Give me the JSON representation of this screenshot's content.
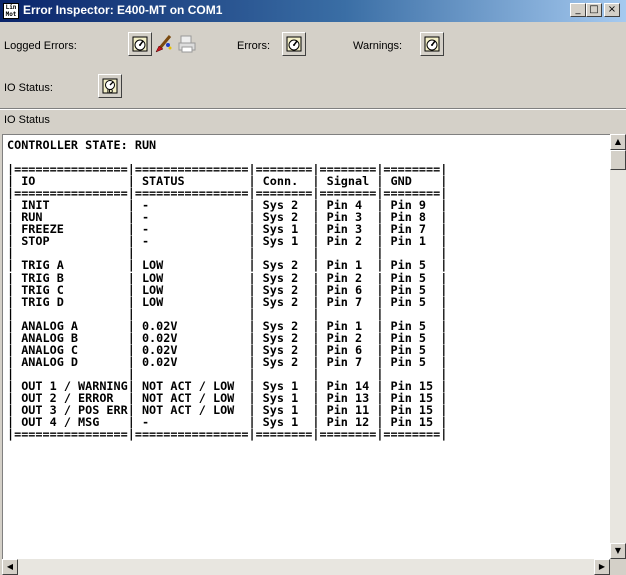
{
  "window": {
    "icon_text": "Lin Mot",
    "title": "Error Inspector: E400-MT on COM1",
    "minimize": "_",
    "maximize": "□",
    "close": "×"
  },
  "toolbar": {
    "logged_errors_label": "Logged Errors:",
    "errors_label": "Errors:",
    "warnings_label": "Warnings:",
    "io_status_label": "IO Status:"
  },
  "panel_caption": "IO Status",
  "terminal_text": "CONTROLLER STATE: RUN\n\n|================|================|========|========|========|\n| IO             | STATUS         | Conn.  | Signal | GND    |\n|================|================|========|========|========|\n| INIT           | -              | Sys 2  | Pin 4  | Pin 9  |\n| RUN            | -              | Sys 2  | Pin 3  | Pin 8  |\n| FREEZE         | -              | Sys 1  | Pin 3  | Pin 7  |\n| STOP           | -              | Sys 1  | Pin 2  | Pin 1  |\n|                |                |        |        |        |\n| TRIG A         | LOW            | Sys 2  | Pin 1  | Pin 5  |\n| TRIG B         | LOW            | Sys 2  | Pin 2  | Pin 5  |\n| TRIG C         | LOW            | Sys 2  | Pin 6  | Pin 5  |\n| TRIG D         | LOW            | Sys 2  | Pin 7  | Pin 5  |\n|                |                |        |        |        |\n| ANALOG A       | 0.02V          | Sys 2  | Pin 1  | Pin 5  |\n| ANALOG B       | 0.02V          | Sys 2  | Pin 2  | Pin 5  |\n| ANALOG C       | 0.02V          | Sys 2  | Pin 6  | Pin 5  |\n| ANALOG D       | 0.02V          | Sys 2  | Pin 7  | Pin 5  |\n|                |                |        |        |        |\n| OUT 1 / WARNING| NOT ACT / LOW  | Sys 1  | Pin 14 | Pin 15 |\n| OUT 2 / ERROR  | NOT ACT / LOW  | Sys 1  | Pin 13 | Pin 15 |\n| OUT 3 / POS ERR| NOT ACT / LOW  | Sys 1  | Pin 11 | Pin 15 |\n| OUT 4 / MSG    | -              | Sys 1  | Pin 12 | Pin 15 |\n|================|================|========|========|========|",
  "scrollbar": {
    "up": "▲",
    "down": "▼",
    "left": "◀",
    "right": "▶"
  },
  "icons": {
    "logged_errors_show": "gauge-icon",
    "logged_errors_clear": "clear-brush-icon",
    "logged_errors_print": "print-icon",
    "errors_show": "gauge-icon",
    "warnings_show": "gauge-icon",
    "io_status_show": "io-gauge-icon"
  }
}
